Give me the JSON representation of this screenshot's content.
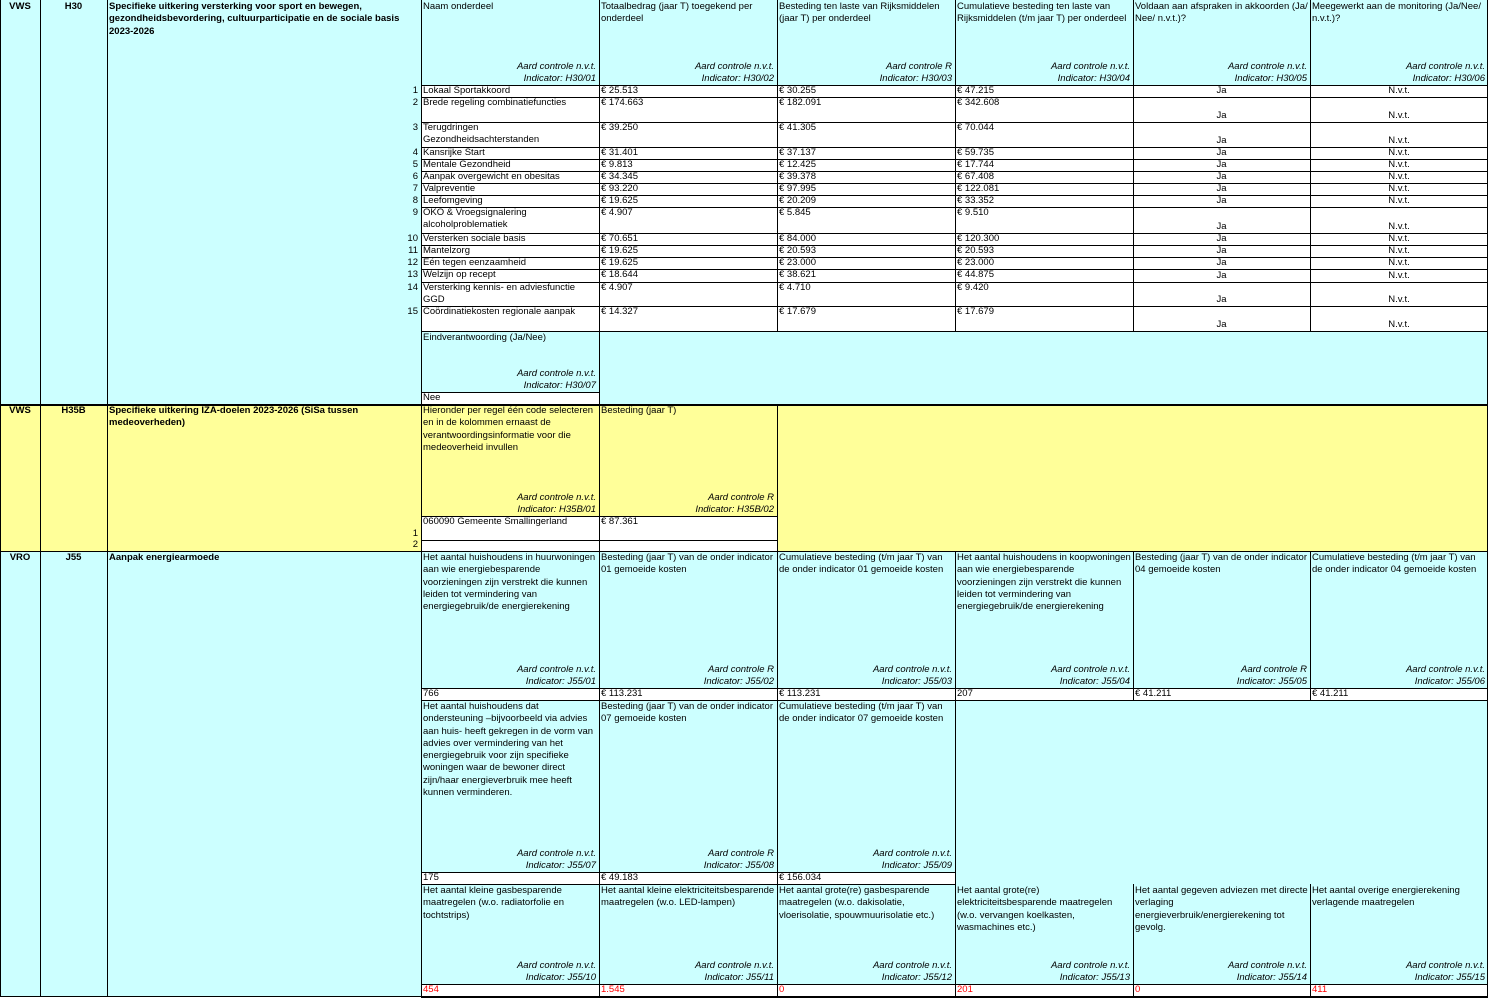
{
  "sections": [
    {
      "ministry": "VWS",
      "code": "H30",
      "title": "Specifieke uitkering versterking voor sport en bewegen, gezondheidsbevordering, cultuurparticipatie en de sociale basis 2023-2026",
      "columns": [
        {
          "header": "Naam onderdeel",
          "control": "Aard controle n.v.t.",
          "indicator": "Indicator: H30/01"
        },
        {
          "header": "Totaalbedrag (jaar T) toegekend per onderdeel",
          "control": "Aard controle n.v.t.",
          "indicator": "Indicator: H30/02"
        },
        {
          "header": "Besteding ten laste van Rijksmiddelen (jaar T) per onderdeel",
          "control": "Aard controle R",
          "indicator": "Indicator: H30/03"
        },
        {
          "header": "Cumulatieve besteding ten laste van Rijksmiddelen (t/m jaar T) per onderdeel",
          "control": "Aard controle n.v.t.",
          "indicator": "Indicator: H30/04"
        },
        {
          "header": "Voldaan aan afspraken in akkoorden (Ja/ Nee/ n.v.t.)?",
          "control": "Aard controle n.v.t.",
          "indicator": "Indicator: H30/05"
        },
        {
          "header": "Meegewerkt aan de monitoring (Ja/Nee/ n.v.t.)?",
          "control": "Aard controle n.v.t.",
          "indicator": "Indicator: H30/06"
        }
      ],
      "rows": [
        {
          "num": "1",
          "name": "Lokaal Sportakkoord",
          "total": "€ 25.513",
          "spent": "€ 30.255",
          "cumulative": "€ 47.215",
          "agreed": "Ja",
          "monitoring": "N.v.t."
        },
        {
          "num": "2",
          "name": "Brede regeling combinatiefuncties",
          "total": "€ 174.663",
          "spent": "€ 182.091",
          "cumulative": "€ 342.608",
          "agreed": "Ja",
          "monitoring": "N.v.t."
        },
        {
          "num": "3",
          "name": "Terugdringen Gezondheidsachterstanden",
          "total": "€ 39.250",
          "spent": "€ 41.305",
          "cumulative": "€ 70.044",
          "agreed": "Ja",
          "monitoring": "N.v.t."
        },
        {
          "num": "4",
          "name": "Kansrijke Start",
          "total": "€ 31.401",
          "spent": "€ 37.137",
          "cumulative": "€ 59.735",
          "agreed": "Ja",
          "monitoring": "N.v.t."
        },
        {
          "num": "5",
          "name": "Mentale Gezondheid",
          "total": "€ 9.813",
          "spent": "€ 12.425",
          "cumulative": "€ 17.744",
          "agreed": "Ja",
          "monitoring": "N.v.t."
        },
        {
          "num": "6",
          "name": "Aanpak overgewicht en obesitas",
          "total": "€ 34.345",
          "spent": "€ 39.378",
          "cumulative": "€ 67.408",
          "agreed": "Ja",
          "monitoring": "N.v.t."
        },
        {
          "num": "7",
          "name": "Valpreventie",
          "total": "€ 93.220",
          "spent": "€ 97.995",
          "cumulative": "€ 122.081",
          "agreed": "Ja",
          "monitoring": "N.v.t."
        },
        {
          "num": "8",
          "name": "Leefomgeving",
          "total": "€ 19.625",
          "spent": "€ 20.209",
          "cumulative": "€ 33.352",
          "agreed": "Ja",
          "monitoring": "N.v.t."
        },
        {
          "num": "9",
          "name": "OKO & Vroegsignalering alcoholproblematiek",
          "total": "€ 4.907",
          "spent": "€ 5.845",
          "cumulative": "€ 9.510",
          "agreed": "Ja",
          "monitoring": "N.v.t."
        },
        {
          "num": "10",
          "name": "Versterken sociale basis",
          "total": "€ 70.651",
          "spent": "€ 84.000",
          "cumulative": "€ 120.300",
          "agreed": "Ja",
          "monitoring": "N.v.t."
        },
        {
          "num": "11",
          "name": "Mantelzorg",
          "total": "€ 19.625",
          "spent": "€ 20.593",
          "cumulative": "€ 20.593",
          "agreed": "Ja",
          "monitoring": "N.v.t."
        },
        {
          "num": "12",
          "name": "Eén tegen eenzaamheid",
          "total": "€ 19.625",
          "spent": "€ 23.000",
          "cumulative": "€ 23.000",
          "agreed": "Ja",
          "monitoring": "N.v.t."
        },
        {
          "num": "13",
          "name": "Welzijn op recept",
          "total": "€ 18.644",
          "spent": "€ 38.621",
          "cumulative": "€ 44.875",
          "agreed": "Ja",
          "monitoring": "N.v.t."
        },
        {
          "num": "14",
          "name": "Versterking kennis- en adviesfunctie GGD",
          "total": "€ 4.907",
          "spent": "€ 4.710",
          "cumulative": "€ 9.420",
          "agreed": "Ja",
          "monitoring": "N.v.t."
        },
        {
          "num": "15",
          "name": "Coördinatiekosten regionale aanpak",
          "total": "€ 14.327",
          "spent": "€ 17.679",
          "cumulative": "€ 17.679",
          "agreed": "Ja",
          "monitoring": "N.v.t."
        }
      ],
      "final": {
        "header": "Eindverantwoording (Ja/Nee)",
        "control": "Aard controle n.v.t.",
        "indicator": "Indicator: H30/07",
        "value": "Nee"
      }
    },
    {
      "ministry": "VWS",
      "code": "H35B",
      "title": "Specifieke uitkering IZA-doelen 2023-2026 (SiSa tussen medeoverheden)",
      "columns": [
        {
          "header": "Hieronder per regel één code selecteren en in de kolommen ernaast de verantwoordingsinformatie voor die medeoverheid invullen",
          "control": "Aard controle n.v.t.",
          "indicator": "Indicator: H35B/01"
        },
        {
          "header": "Besteding (jaar T)",
          "control": "Aard controle R",
          "indicator": "Indicator: H35B/02"
        }
      ],
      "rows": [
        {
          "num": "1",
          "code": "060090 Gemeente Smallingerland",
          "spent": "€ 87.361"
        },
        {
          "num": "2",
          "code": "",
          "spent": ""
        }
      ]
    },
    {
      "ministry": "VRO",
      "code": "J55",
      "title": "Aanpak energiearmoede",
      "blocks": [
        [
          {
            "header": "Het aantal huishoudens in huurwoningen aan wie energiebesparende voorzieningen zijn verstrekt die kunnen leiden tot vermindering van energiegebruik/de energierekening",
            "control": "Aard controle n.v.t.",
            "indicator": "Indicator: J55/01",
            "value": "766"
          },
          {
            "header": "Besteding (jaar T) van de onder indicator 01 gemoeide kosten",
            "control": "Aard controle R",
            "indicator": "Indicator: J55/02",
            "value": "€ 113.231"
          },
          {
            "header": "Cumulatieve besteding (t/m jaar T) van de onder indicator 01 gemoeide kosten",
            "control": "Aard controle n.v.t.",
            "indicator": "Indicator: J55/03",
            "value": "€ 113.231"
          },
          {
            "header": "Het aantal huishoudens in koopwoningen aan wie energiebesparende voorzieningen zijn verstrekt die kunnen leiden tot vermindering van energiegebruik/de energierekening",
            "control": "Aard controle n.v.t.",
            "indicator": "Indicator: J55/04",
            "value": "207"
          },
          {
            "header": "Besteding (jaar T) van de onder indicator 04 gemoeide kosten",
            "control": "Aard controle R",
            "indicator": "Indicator: J55/05",
            "value": "€ 41.211"
          },
          {
            "header": "Cumulatieve besteding (t/m jaar T) van de onder indicator 04 gemoeide kosten",
            "control": "Aard controle n.v.t.",
            "indicator": "Indicator: J55/06",
            "value": "€ 41.211"
          }
        ],
        [
          {
            "header": "Het aantal huishoudens dat ondersteuning –bijvoorbeeld via advies aan huis- heeft gekregen in de vorm van advies over vermindering van het energiegebruik voor zijn specifieke  woningen waar de bewoner direct zijn/haar energieverbruik mee heeft kunnen verminderen.",
            "control": "Aard controle n.v.t.",
            "indicator": "Indicator: J55/07",
            "value": "175"
          },
          {
            "header": "Besteding (jaar T) van de onder indicator 07 gemoeide kosten",
            "control": "Aard controle R",
            "indicator": "Indicator: J55/08",
            "value": "€ 49.183"
          },
          {
            "header": "Cumulatieve besteding (t/m jaar T) van de onder indicator 07 gemoeide kosten",
            "control": "Aard controle n.v.t.",
            "indicator": "Indicator: J55/09",
            "value": "€ 156.034"
          }
        ],
        [
          {
            "header": "Het aantal kleine gasbesparende maatregelen (w.o. radiatorfolie en tochtstrips)",
            "control": "Aard controle n.v.t.",
            "indicator": "Indicator: J55/10",
            "value": "454"
          },
          {
            "header": "Het aantal kleine elektriciteitsbesparende maatregelen (w.o. LED-lampen)",
            "control": "Aard controle n.v.t.",
            "indicator": "Indicator: J55/11",
            "value": "1.545"
          },
          {
            "header": "Het aantal grote(re) gasbesparende maatregelen (w.o. dakisolatie, vloerisolatie, spouwmuurisolatie etc.)",
            "control": "Aard controle n.v.t.",
            "indicator": "Indicator: J55/12",
            "value": "0"
          },
          {
            "header": "Het aantal grote(re) elektriciteitsbesparende maatregelen (w.o. vervangen koelkasten, wasmachines etc.)",
            "control": "Aard controle n.v.t.",
            "indicator": "Indicator: J55/13",
            "value": "201"
          },
          {
            "header": "Het aantal gegeven adviezen met directe verlaging energieverbruik/energierekening tot gevolg.",
            "control": "Aard controle n.v.t.",
            "indicator": "Indicator: J55/14",
            "value": "0"
          },
          {
            "header": "Het aantal overige energierekening verlagende maatregelen",
            "control": "Aard controle n.v.t.",
            "indicator": "Indicator: J55/15",
            "value": "411"
          }
        ]
      ]
    }
  ],
  "colors": {
    "cyan": "#ccffff",
    "yellow": "#ffff99",
    "border": "#000000",
    "red_value": "#ff0000"
  }
}
